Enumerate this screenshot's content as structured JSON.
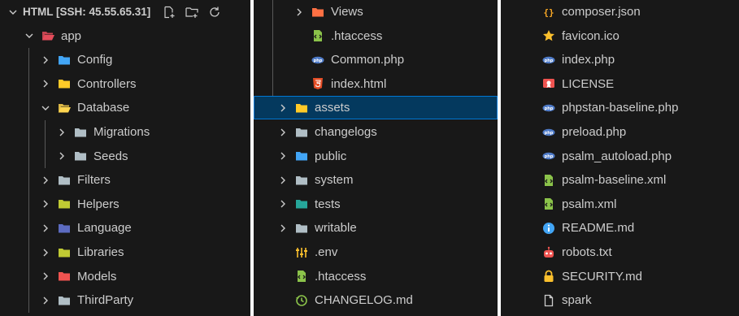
{
  "explorer": {
    "root_title": "HTML [SSH: 45.55.65.31]",
    "header_actions": [
      "new-file-icon",
      "new-folder-icon",
      "refresh-icon"
    ],
    "column1": [
      {
        "label": "HTML [SSH: 45.55.65.31]",
        "depth": 0,
        "kind": "root",
        "open": true
      },
      {
        "label": "app",
        "depth": 1,
        "kind": "folder",
        "icon": "folder-app-icon",
        "color": "#e34c5a",
        "open": true
      },
      {
        "label": "Config",
        "depth": 2,
        "kind": "folder",
        "icon": "folder-config-icon",
        "color": "#42a5f5",
        "open": false
      },
      {
        "label": "Controllers",
        "depth": 2,
        "kind": "folder",
        "icon": "folder-controllers-icon",
        "color": "#ffca28",
        "open": false
      },
      {
        "label": "Database",
        "depth": 2,
        "kind": "folder",
        "icon": "folder-database-icon",
        "color": "#ffd54f",
        "open": true
      },
      {
        "label": "Migrations",
        "depth": 3,
        "kind": "folder",
        "icon": "folder-icon",
        "color": "#b0bec5",
        "open": false
      },
      {
        "label": "Seeds",
        "depth": 3,
        "kind": "folder",
        "icon": "folder-icon",
        "color": "#b0bec5",
        "open": false
      },
      {
        "label": "Filters",
        "depth": 2,
        "kind": "folder",
        "icon": "folder-icon",
        "color": "#b0bec5",
        "open": false
      },
      {
        "label": "Helpers",
        "depth": 2,
        "kind": "folder",
        "icon": "folder-helpers-icon",
        "color": "#c0ca33",
        "open": false
      },
      {
        "label": "Language",
        "depth": 2,
        "kind": "folder",
        "icon": "folder-language-icon",
        "color": "#5c6bc0",
        "open": false
      },
      {
        "label": "Libraries",
        "depth": 2,
        "kind": "folder",
        "icon": "folder-libraries-icon",
        "color": "#c0ca33",
        "open": false
      },
      {
        "label": "Models",
        "depth": 2,
        "kind": "folder",
        "icon": "folder-models-icon",
        "color": "#ef5350",
        "open": false
      },
      {
        "label": "ThirdParty",
        "depth": 2,
        "kind": "folder",
        "icon": "folder-icon",
        "color": "#b0bec5",
        "open": false
      }
    ],
    "column2": [
      {
        "label": "Views",
        "depth": 2,
        "kind": "folder",
        "icon": "folder-views-icon",
        "color": "#ff7043",
        "open": false
      },
      {
        "label": ".htaccess",
        "depth": 2,
        "kind": "file",
        "icon": "htaccess-icon",
        "color": "#8bc34a"
      },
      {
        "label": "Common.php",
        "depth": 2,
        "kind": "file",
        "icon": "php-icon",
        "color": "#4f7bc8"
      },
      {
        "label": "index.html",
        "depth": 2,
        "kind": "file",
        "icon": "html-icon",
        "color": "#e44d26"
      },
      {
        "label": "assets",
        "depth": 1,
        "kind": "folder",
        "icon": "folder-assets-icon",
        "color": "#ffca28",
        "open": false,
        "selected": true
      },
      {
        "label": "changelogs",
        "depth": 1,
        "kind": "folder",
        "icon": "folder-icon",
        "color": "#b0bec5",
        "open": false
      },
      {
        "label": "public",
        "depth": 1,
        "kind": "folder",
        "icon": "folder-public-icon",
        "color": "#42a5f5",
        "open": false
      },
      {
        "label": "system",
        "depth": 1,
        "kind": "folder",
        "icon": "folder-icon",
        "color": "#b0bec5",
        "open": false
      },
      {
        "label": "tests",
        "depth": 1,
        "kind": "folder",
        "icon": "folder-tests-icon",
        "color": "#26a69a",
        "open": false
      },
      {
        "label": "writable",
        "depth": 1,
        "kind": "folder",
        "icon": "folder-icon",
        "color": "#b0bec5",
        "open": false
      },
      {
        "label": ".env",
        "depth": 1,
        "kind": "file",
        "icon": "env-icon",
        "color": "#fbc02d"
      },
      {
        "label": ".htaccess",
        "depth": 1,
        "kind": "file",
        "icon": "htaccess-icon",
        "color": "#8bc34a"
      },
      {
        "label": "CHANGELOG.md",
        "depth": 1,
        "kind": "file",
        "icon": "changelog-icon",
        "color": "#8bc34a"
      }
    ],
    "column3": [
      {
        "label": "composer.json",
        "depth": 1,
        "kind": "file",
        "icon": "json-icon",
        "color": "#f9a825"
      },
      {
        "label": "favicon.ico",
        "depth": 1,
        "kind": "file",
        "icon": "star-icon",
        "color": "#fbc02d"
      },
      {
        "label": "index.php",
        "depth": 1,
        "kind": "file",
        "icon": "php-icon",
        "color": "#4f7bc8"
      },
      {
        "label": "LICENSE",
        "depth": 1,
        "kind": "file",
        "icon": "license-icon",
        "color": "#ef5350"
      },
      {
        "label": "phpstan-baseline.php",
        "depth": 1,
        "kind": "file",
        "icon": "php-icon",
        "color": "#4f7bc8"
      },
      {
        "label": "preload.php",
        "depth": 1,
        "kind": "file",
        "icon": "php-icon",
        "color": "#4f7bc8"
      },
      {
        "label": "psalm_autoload.php",
        "depth": 1,
        "kind": "file",
        "icon": "php-icon",
        "color": "#4f7bc8"
      },
      {
        "label": "psalm-baseline.xml",
        "depth": 1,
        "kind": "file",
        "icon": "xml-icon",
        "color": "#8bc34a"
      },
      {
        "label": "psalm.xml",
        "depth": 1,
        "kind": "file",
        "icon": "xml-icon",
        "color": "#8bc34a"
      },
      {
        "label": "README.md",
        "depth": 1,
        "kind": "file",
        "icon": "info-icon",
        "color": "#42a5f5"
      },
      {
        "label": "robots.txt",
        "depth": 1,
        "kind": "file",
        "icon": "robot-icon",
        "color": "#ef5350"
      },
      {
        "label": "SECURITY.md",
        "depth": 1,
        "kind": "file",
        "icon": "lock-icon",
        "color": "#fbc02d"
      },
      {
        "label": "spark",
        "depth": 1,
        "kind": "file",
        "icon": "file-icon",
        "color": "#cccccc"
      }
    ]
  },
  "colors": {
    "background": "#181818",
    "selection": "#04395e",
    "selection_border": "#0078d4",
    "text": "#cccccc",
    "indent_guide": "#585858"
  }
}
